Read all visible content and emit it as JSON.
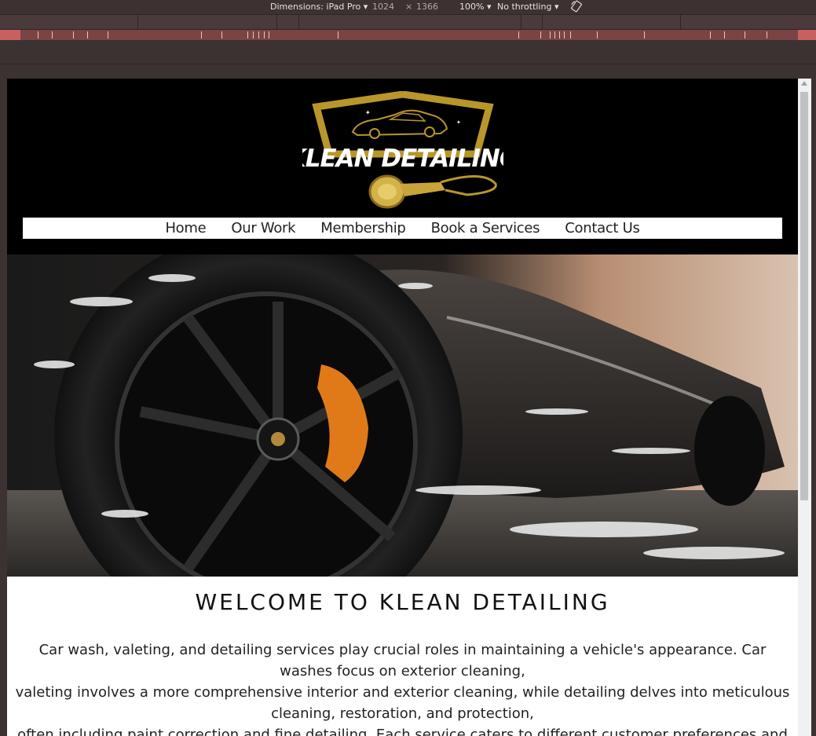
{
  "devtools": {
    "dimensions_label": "Dimensions: iPad Pro",
    "width": "1024",
    "times": "×",
    "height": "1366",
    "zoom": "100%",
    "throttling": "No throttling"
  },
  "site": {
    "brand": "KLEAN DETAILING",
    "colors": {
      "header_bg": "#000000",
      "gold": "#b8962a"
    }
  },
  "nav": {
    "items": [
      "Home",
      "Our Work",
      "Membership",
      "Book a Services",
      "Contact Us"
    ]
  },
  "hero": {
    "image": "wet black sports car wheel with orange brake caliper"
  },
  "welcome": {
    "title": "WELCOME TO KLEAN DETAILING",
    "lines": [
      "Car wash, valeting, and detailing services play crucial roles in maintaining a vehicle's appearance. Car washes focus on exterior cleaning,",
      "valeting involves a more comprehensive interior and exterior cleaning, while detailing delves into meticulous cleaning, restoration, and protection,",
      "often including paint correction and fine detailing. Each service caters to different customer preferences and"
    ]
  }
}
